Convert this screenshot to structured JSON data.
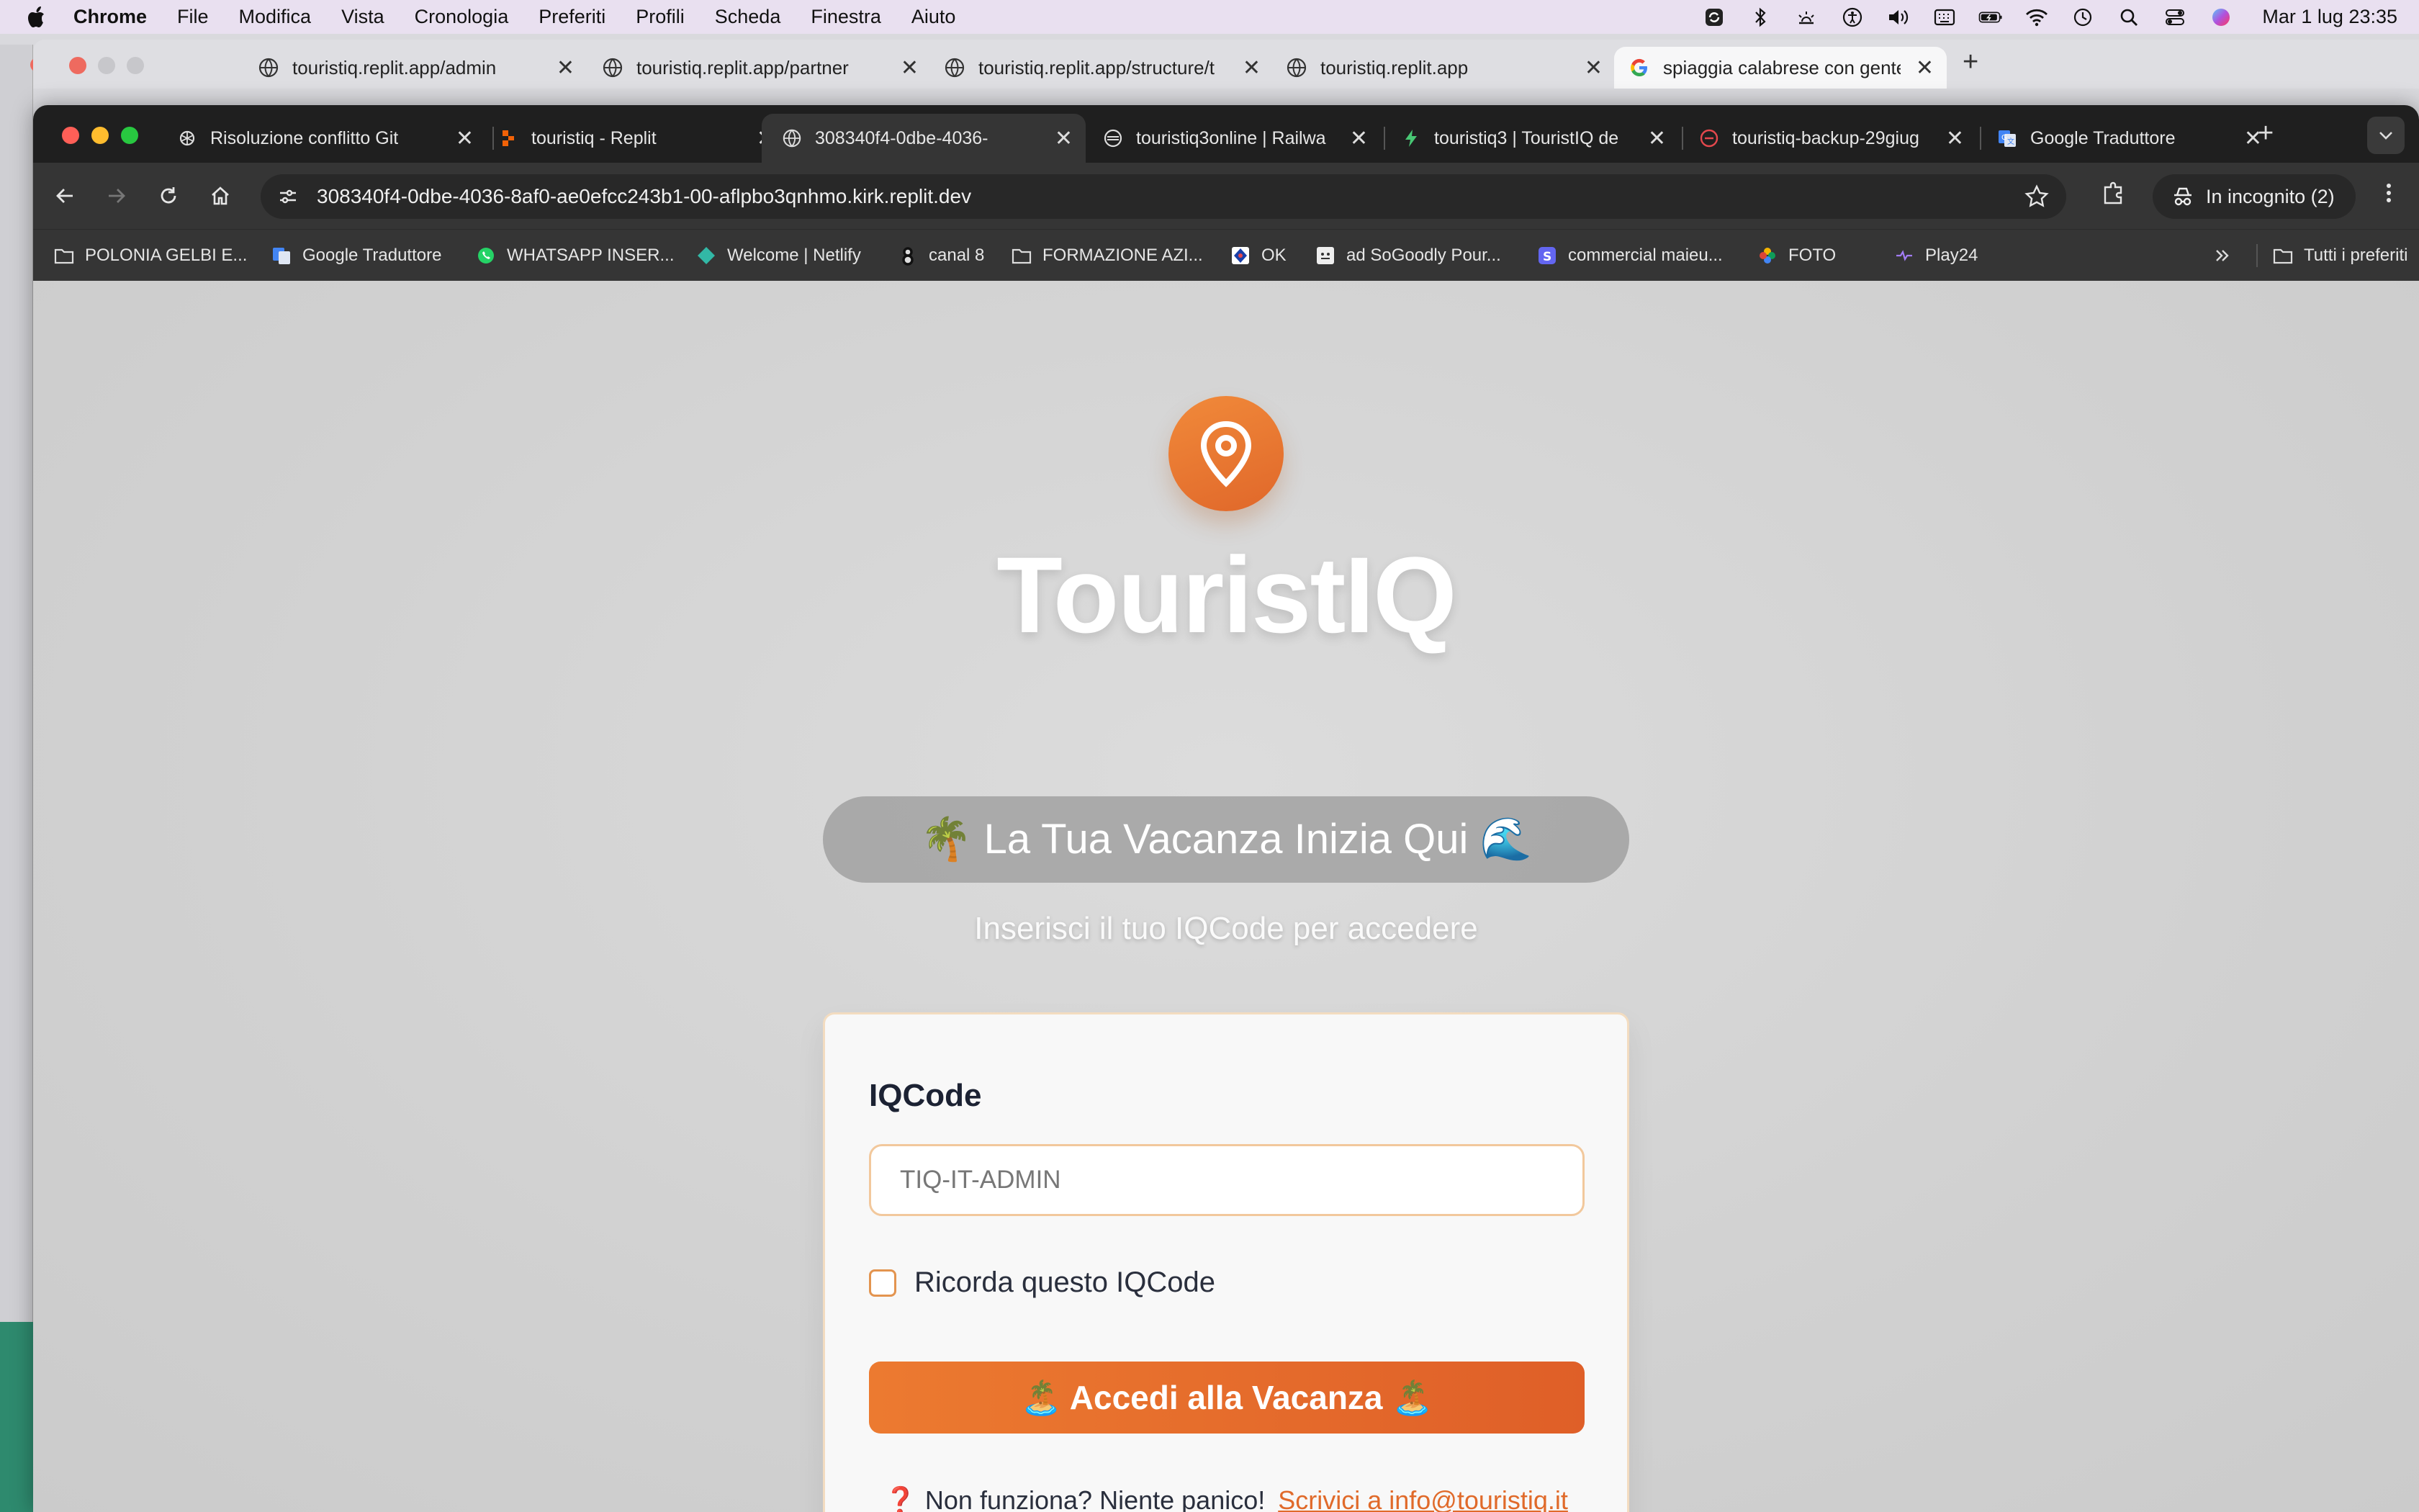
{
  "menubar": {
    "app": "Chrome",
    "items": [
      "File",
      "Modifica",
      "Vista",
      "Cronologia",
      "Preferiti",
      "Profili",
      "Scheda",
      "Finestra",
      "Aiuto"
    ],
    "clock": "Mar 1 lug  23:35"
  },
  "back_window": {
    "tabs": [
      {
        "title": "touristiq.replit.app/admin"
      },
      {
        "title": "touristiq.replit.app/partner"
      },
      {
        "title": "touristiq.replit.app/structure/t"
      },
      {
        "title": "touristiq.replit.app"
      },
      {
        "title": "spiaggia calabrese con gente"
      }
    ]
  },
  "front_window": {
    "tabs": [
      {
        "title": "Risoluzione conflitto Git"
      },
      {
        "title": "touristiq - Replit"
      },
      {
        "title": "308340f4-0dbe-4036-"
      },
      {
        "title": "touristiq3online | Railwa"
      },
      {
        "title": "touristiq3 | TouristIQ de"
      },
      {
        "title": "touristiq-backup-29giug"
      },
      {
        "title": "Google Traduttore"
      }
    ],
    "address": "308340f4-0dbe-4036-8af0-ae0efcc243b1-00-aflpbo3qnhmo.kirk.replit.dev",
    "incognito": "In incognito (2)",
    "bookmarks": [
      {
        "label": "POLONIA GELBI E...",
        "icon": "folder-icon"
      },
      {
        "label": "Google Traduttore",
        "icon": "translate-icon"
      },
      {
        "label": "WHATSAPP INSER...",
        "icon": "whatsapp-icon"
      },
      {
        "label": "Welcome | Netlify",
        "icon": "netlify-icon"
      },
      {
        "label": "canal 8",
        "icon": "canal8-icon"
      },
      {
        "label": "FORMAZIONE AZI...",
        "icon": "folder-icon"
      },
      {
        "label": "OK",
        "icon": "ok-icon"
      },
      {
        "label": "ad SoGoodly Pour...",
        "icon": "sogoodly-icon"
      },
      {
        "label": "commercial maieu...",
        "icon": "s-icon"
      },
      {
        "label": "FOTO",
        "icon": "photos-icon"
      },
      {
        "label": "Play24",
        "icon": "play24-icon"
      }
    ],
    "all_bookmarks": "Tutti i preferiti"
  },
  "page": {
    "brand": "TouristIQ",
    "tagline": "🌴 La Tua Vacanza Inizia Qui 🌊",
    "subtitle": "Inserisci il tuo IQCode per accedere",
    "form": {
      "label": "IQCode",
      "placeholder": "TIQ-IT-ADMIN",
      "remember": "Ricorda questo IQCode",
      "submit": "🏝️ Accedi alla Vacanza 🏝️",
      "help_text": "Non funziona? Niente panico!",
      "help_link": "Scrivici a info@touristiq.it"
    }
  },
  "colors": {
    "accent": "#e8702d",
    "accent_dark": "#df5f28",
    "heading": "#1c2233"
  }
}
